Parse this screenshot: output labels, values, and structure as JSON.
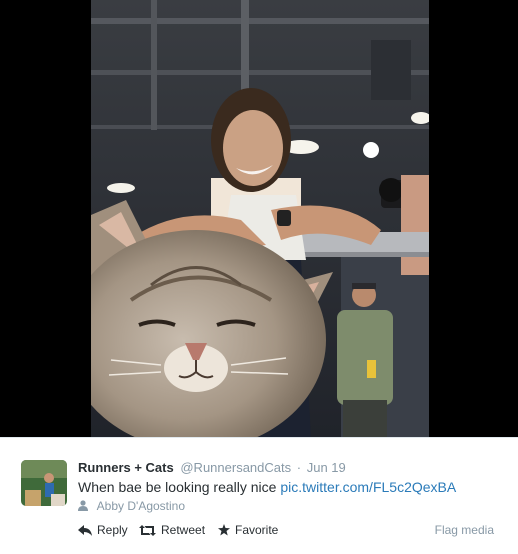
{
  "tweet": {
    "display_name": "Runners + Cats",
    "screen_name": "@RunnersandCats",
    "separator": "·",
    "timestamp": "Jun 19",
    "text": "When bae be looking really nice",
    "link": "pic.twitter.com/FL5c2QexBA",
    "attribution": "Abby D'Agostino"
  },
  "actions": {
    "reply": "Reply",
    "retweet": "Retweet",
    "favorite": "Favorite",
    "flag": "Flag media"
  },
  "colors": {
    "media_background": "#000000",
    "link": "#2b7bb9",
    "muted_text": "#8899a6",
    "body_text": "#292f33"
  },
  "icons": [
    "reply-icon",
    "retweet-icon",
    "favorite-star-icon",
    "person-icon"
  ]
}
